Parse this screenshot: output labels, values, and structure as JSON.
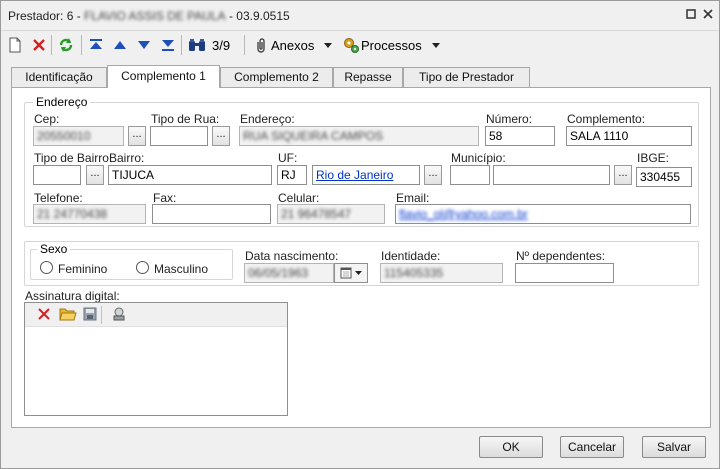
{
  "window": {
    "title_prefix": "Prestador: 6 - ",
    "title_name": "FLAVIO ASSIS DE PAULA",
    "title_suffix": " - 03.9.0515"
  },
  "toolbar": {
    "record_counter": "3/9",
    "anexos_label": "Anexos",
    "processos_label": "Processos"
  },
  "tabs": [
    {
      "label": "Identificação"
    },
    {
      "label": "Complemento 1"
    },
    {
      "label": "Complemento 2"
    },
    {
      "label": "Repasse"
    },
    {
      "label": "Tipo de Prestador"
    }
  ],
  "endereco": {
    "legend": "Endereço",
    "cep_label": "Cep:",
    "cep_value": "20550010",
    "tipo_rua_label": "Tipo de Rua:",
    "tipo_rua_value": "",
    "endereco_label": "Endereço:",
    "endereco_value": "RUA SIQUEIRA CAMPOS",
    "numero_label": "Número:",
    "numero_value": "58",
    "complemento_label": "Complemento:",
    "complemento_value": "SALA 1110",
    "tipo_bairro_label": "Tipo de Bairro:",
    "tipo_bairro_value": "",
    "bairro_label": "Bairro:",
    "bairro_value": "TIJUCA",
    "uf_label": "UF:",
    "uf_value": "RJ",
    "uf_city_link": "Rio de Janeiro",
    "municipio_label": "Município:",
    "municipio_code": "",
    "municipio_name": "",
    "ibge_label": "IBGE:",
    "ibge_value": "330455",
    "telefone_label": "Telefone:",
    "telefone_value": "21 24770438",
    "fax_label": "Fax:",
    "fax_value": "",
    "celular_label": "Celular:",
    "celular_value": "21 96478547",
    "email_label": "Email:",
    "email_value": "flavio_ol@yahoo.com.br"
  },
  "pessoal": {
    "sexo_legend": "Sexo",
    "feminino_label": "Feminino",
    "masculino_label": "Masculino",
    "data_nasc_label": "Data nascimento:",
    "data_nasc_value": "06/05/1963",
    "identidade_label": "Identidade:",
    "identidade_value": "115405335",
    "dependentes_label": "Nº dependentes:",
    "dependentes_value": ""
  },
  "assinatura": {
    "label": "Assinatura digital:"
  },
  "buttons": {
    "ok": "OK",
    "cancelar": "Cancelar",
    "salvar": "Salvar"
  },
  "colors": {
    "link": "#0033cc",
    "delete_red": "#d42020",
    "arrow_blue": "#1f4fb8",
    "refresh_green": "#2a9a2a"
  }
}
